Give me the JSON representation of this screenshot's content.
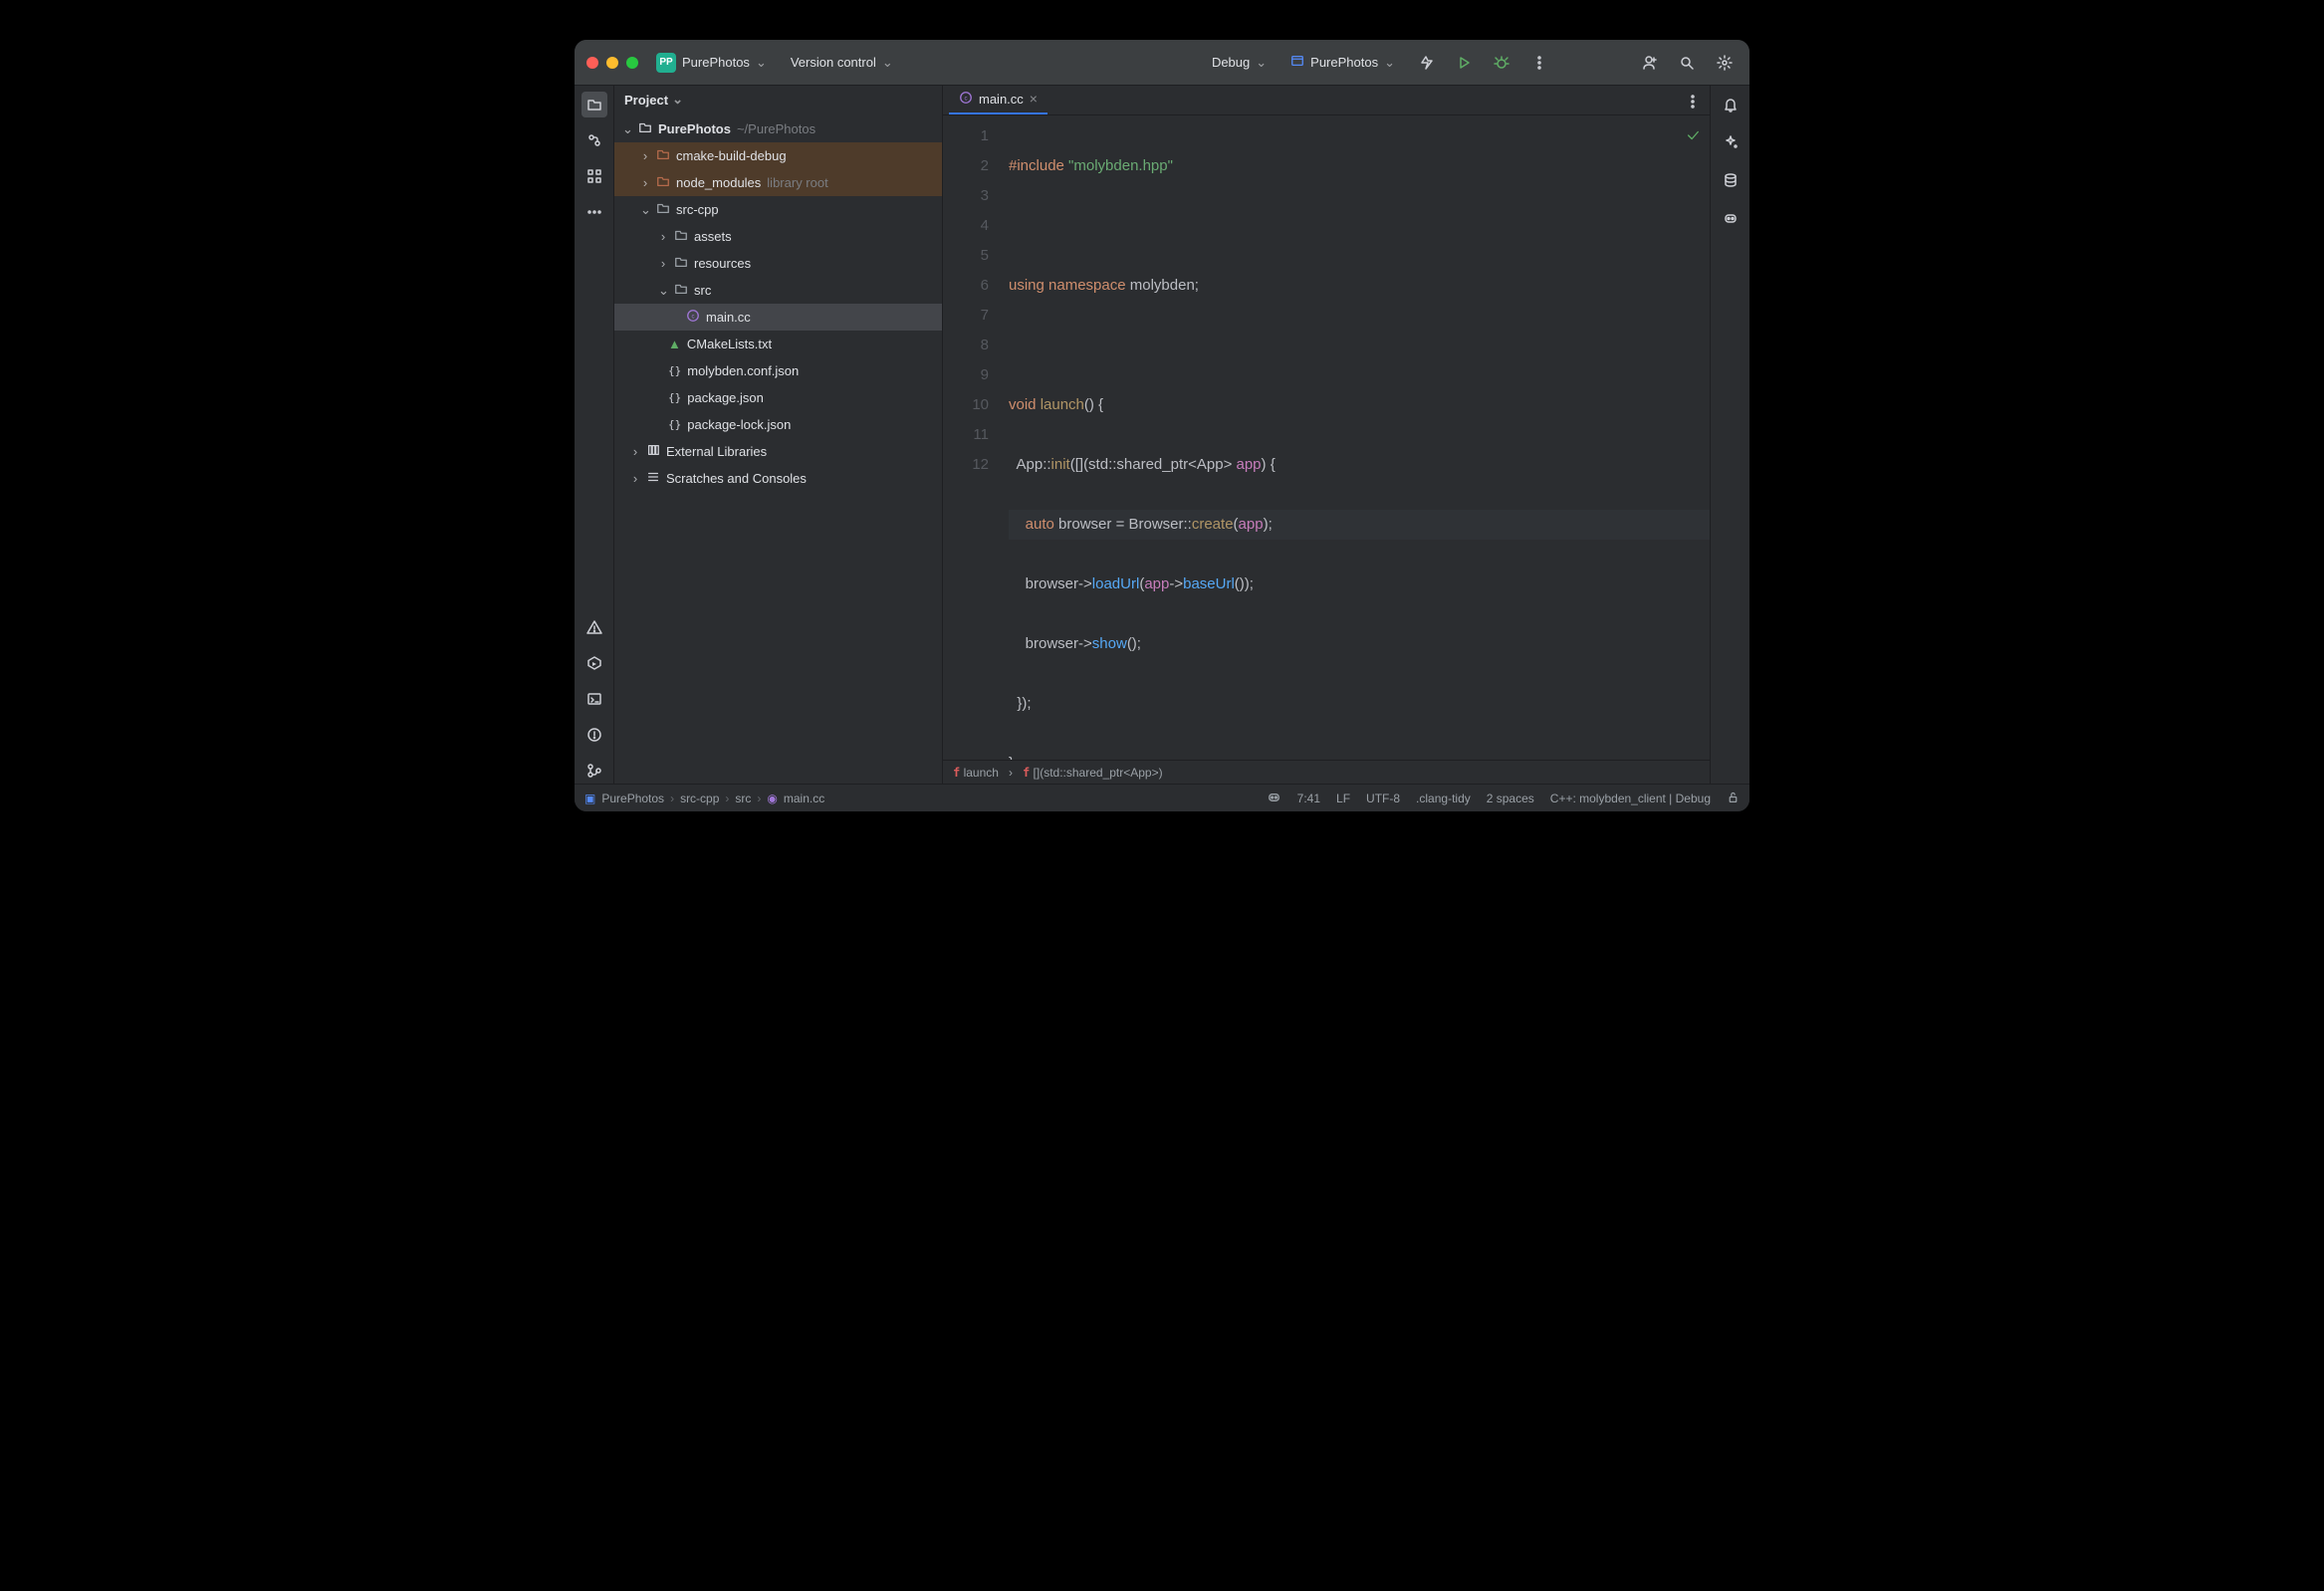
{
  "titlebar": {
    "project_badge": "PP",
    "project_name": "PurePhotos",
    "vcs_label": "Version control",
    "run_config": "Debug",
    "target_name": "PurePhotos"
  },
  "panel": {
    "title": "Project"
  },
  "tree": {
    "root_name": "PurePhotos",
    "root_path": "~/PurePhotos",
    "cmake": "cmake-build-debug",
    "node_modules": "node_modules",
    "node_modules_hint": "library root",
    "src_cpp": "src-cpp",
    "assets": "assets",
    "resources": "resources",
    "src": "src",
    "main": "main.cc",
    "cmakelists": "CMakeLists.txt",
    "conf": "molybden.conf.json",
    "pkg": "package.json",
    "pkglock": "package-lock.json",
    "ext": "External Libraries",
    "scratches": "Scratches and Consoles"
  },
  "tab": {
    "name": "main.cc"
  },
  "gutter": [
    "1",
    "2",
    "3",
    "4",
    "5",
    "6",
    "7",
    "8",
    "9",
    "10",
    "11",
    "12"
  ],
  "code": {
    "l1a": "#include ",
    "l1b": "\"molybden.hpp\"",
    "l3a": "using ",
    "l3b": "namespace ",
    "l3c": "molybden;",
    "l5a": "void ",
    "l5b": "launch",
    "l5c": "() {",
    "l6a": "  App::",
    "l6b": "init",
    "l6c": "([](std::shared_ptr<App> ",
    "l6d": "app",
    "l6e": ") {",
    "l7a": "    ",
    "l7b": "auto ",
    "l7c": "browser = Browser::",
    "l7d": "create",
    "l7e": "(",
    "l7f": "app",
    "l7g": ");",
    "l8a": "    browser->",
    "l8b": "loadUrl",
    "l8c": "(",
    "l8d": "app",
    "l8e": "->",
    "l8f": "baseUrl",
    "l8g": "());",
    "l9a": "    browser->",
    "l9b": "show",
    "l9c": "();",
    "l10": "  });",
    "l11": "}"
  },
  "breadcrumb": {
    "fn": "launch",
    "lambda": "[](std::shared_ptr<App>)"
  },
  "status": {
    "path": [
      "PurePhotos",
      "src-cpp",
      "src",
      "main.cc"
    ],
    "pos": "7:41",
    "eol": "LF",
    "enc": "UTF-8",
    "lint": ".clang-tidy",
    "indent": "2 spaces",
    "config": "C++: molybden_client | Debug"
  }
}
